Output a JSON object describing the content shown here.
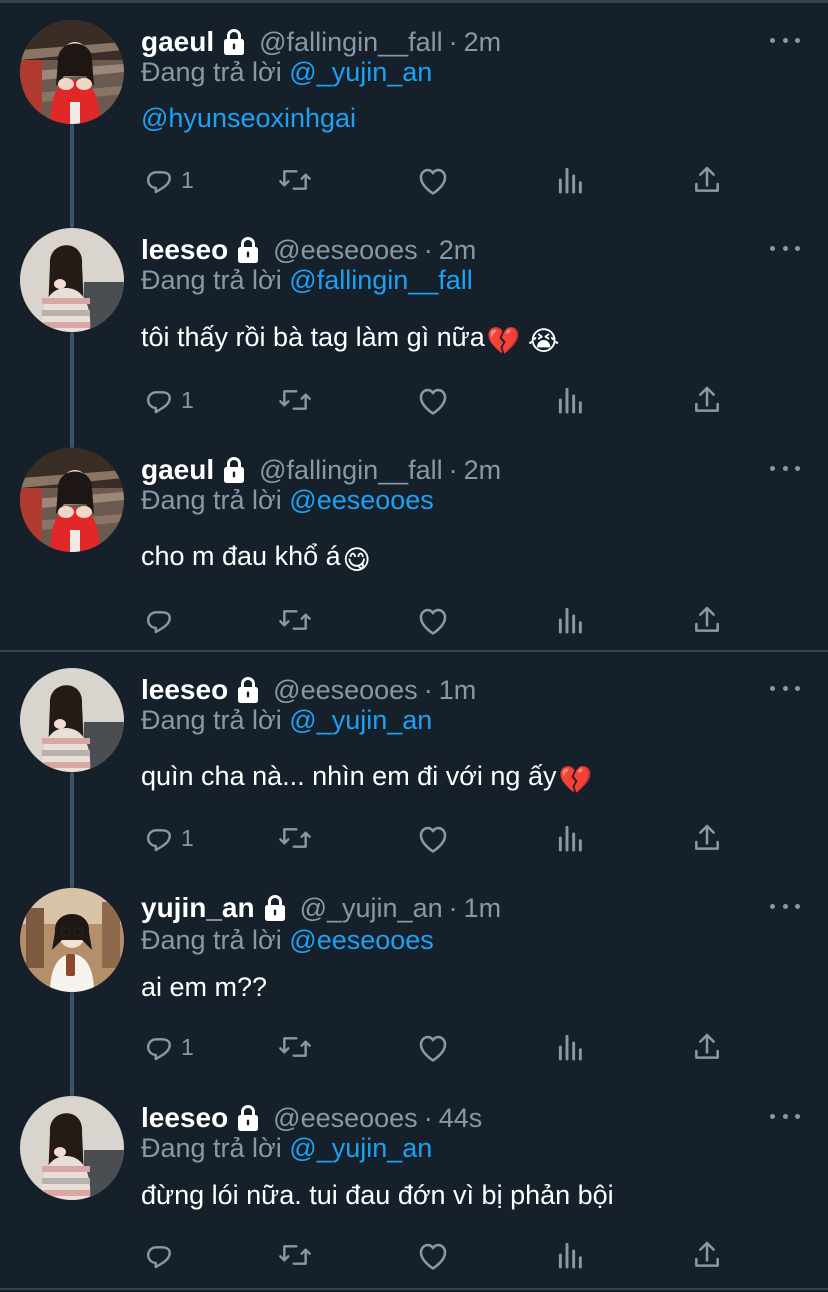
{
  "tweets": [
    {
      "name": "gaeul",
      "handle": "@fallingin__fall",
      "time": "2m",
      "replying_prefix": "Đang trả lời",
      "replying_to": "@_yujin_an",
      "text": "@hyunseoxinhgai",
      "text_emoji": "",
      "text_is_link": true,
      "reply_count": "1",
      "avatar": "gaeul"
    },
    {
      "name": "leeseo",
      "handle": "@eeseooes",
      "time": "2m",
      "replying_prefix": "Đang trả lời",
      "replying_to": "@fallingin__fall",
      "text": "tôi thấy rồi bà tag làm gì nữa",
      "text_emoji": "💔 😭",
      "text_is_link": false,
      "reply_count": "1",
      "avatar": "leeseo"
    },
    {
      "name": "gaeul",
      "handle": "@fallingin__fall",
      "time": "2m",
      "replying_prefix": "Đang trả lời",
      "replying_to": "@eeseooes",
      "text": "cho m đau khổ á",
      "text_emoji": "😋",
      "text_is_link": false,
      "reply_count": "",
      "avatar": "gaeul"
    },
    {
      "name": "leeseo",
      "handle": "@eeseooes",
      "time": "1m",
      "replying_prefix": "Đang trả lời",
      "replying_to": "@_yujin_an",
      "text": "quìn cha nà... nhìn em đi với ng ấy",
      "text_emoji": "💔",
      "text_is_link": false,
      "reply_count": "1",
      "avatar": "leeseo"
    },
    {
      "name": "yujin_an",
      "handle": "@_yujin_an",
      "time": "1m",
      "replying_prefix": "Đang trả lời",
      "replying_to": "@eeseooes",
      "text": "ai em m??",
      "text_emoji": "",
      "text_is_link": false,
      "reply_count": "1",
      "avatar": "yujin"
    },
    {
      "name": "leeseo",
      "handle": "@eeseooes",
      "time": "44s",
      "replying_prefix": "Đang trả lời",
      "replying_to": "@_yujin_an",
      "text": "đừng lói nữa. tui đau đớn vì bị phản bội",
      "text_emoji": "",
      "text_is_link": false,
      "reply_count": "",
      "avatar": "leeseo"
    }
  ],
  "icons": {
    "reply": "reply-icon",
    "retweet": "retweet-icon",
    "like": "like-icon",
    "analytics": "analytics-icon",
    "share": "share-icon",
    "lock": "lock-icon",
    "more": "more-icon"
  },
  "colors": {
    "background": "#15202b",
    "text": "#ffffff",
    "secondary": "#8899a6",
    "accent": "#1da1f2",
    "border": "#38444d"
  }
}
